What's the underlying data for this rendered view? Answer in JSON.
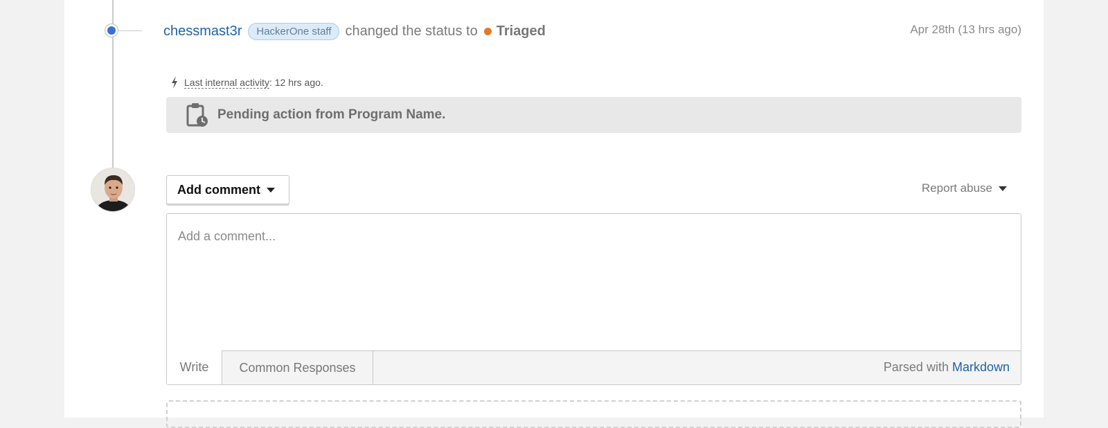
{
  "event": {
    "username": "chessmast3r",
    "badge": "HackerOne staff",
    "changed_text": "changed the status to",
    "status": "Triaged",
    "timestamp": "Apr 28th (13 hrs ago)",
    "status_color": "#e07a2b"
  },
  "internal_activity": {
    "label": "Last internal activity",
    "value": ": 12 hrs ago."
  },
  "pending": {
    "text": "Pending action from Program Name."
  },
  "comment": {
    "add_label": "Add comment",
    "report_label": "Report abuse",
    "placeholder": "Add a comment...",
    "tab_write": "Write",
    "tab_common": "Common Responses",
    "parsed_prefix": "Parsed with",
    "parsed_link": "Markdown"
  },
  "icons": [
    "bolt-icon",
    "clipboard-clock-icon",
    "caret-down-icon"
  ],
  "colors": {
    "accent": "#1e62a8",
    "timeline_dot": "#3a6fd8",
    "badge_bg": "#dcebf7"
  }
}
